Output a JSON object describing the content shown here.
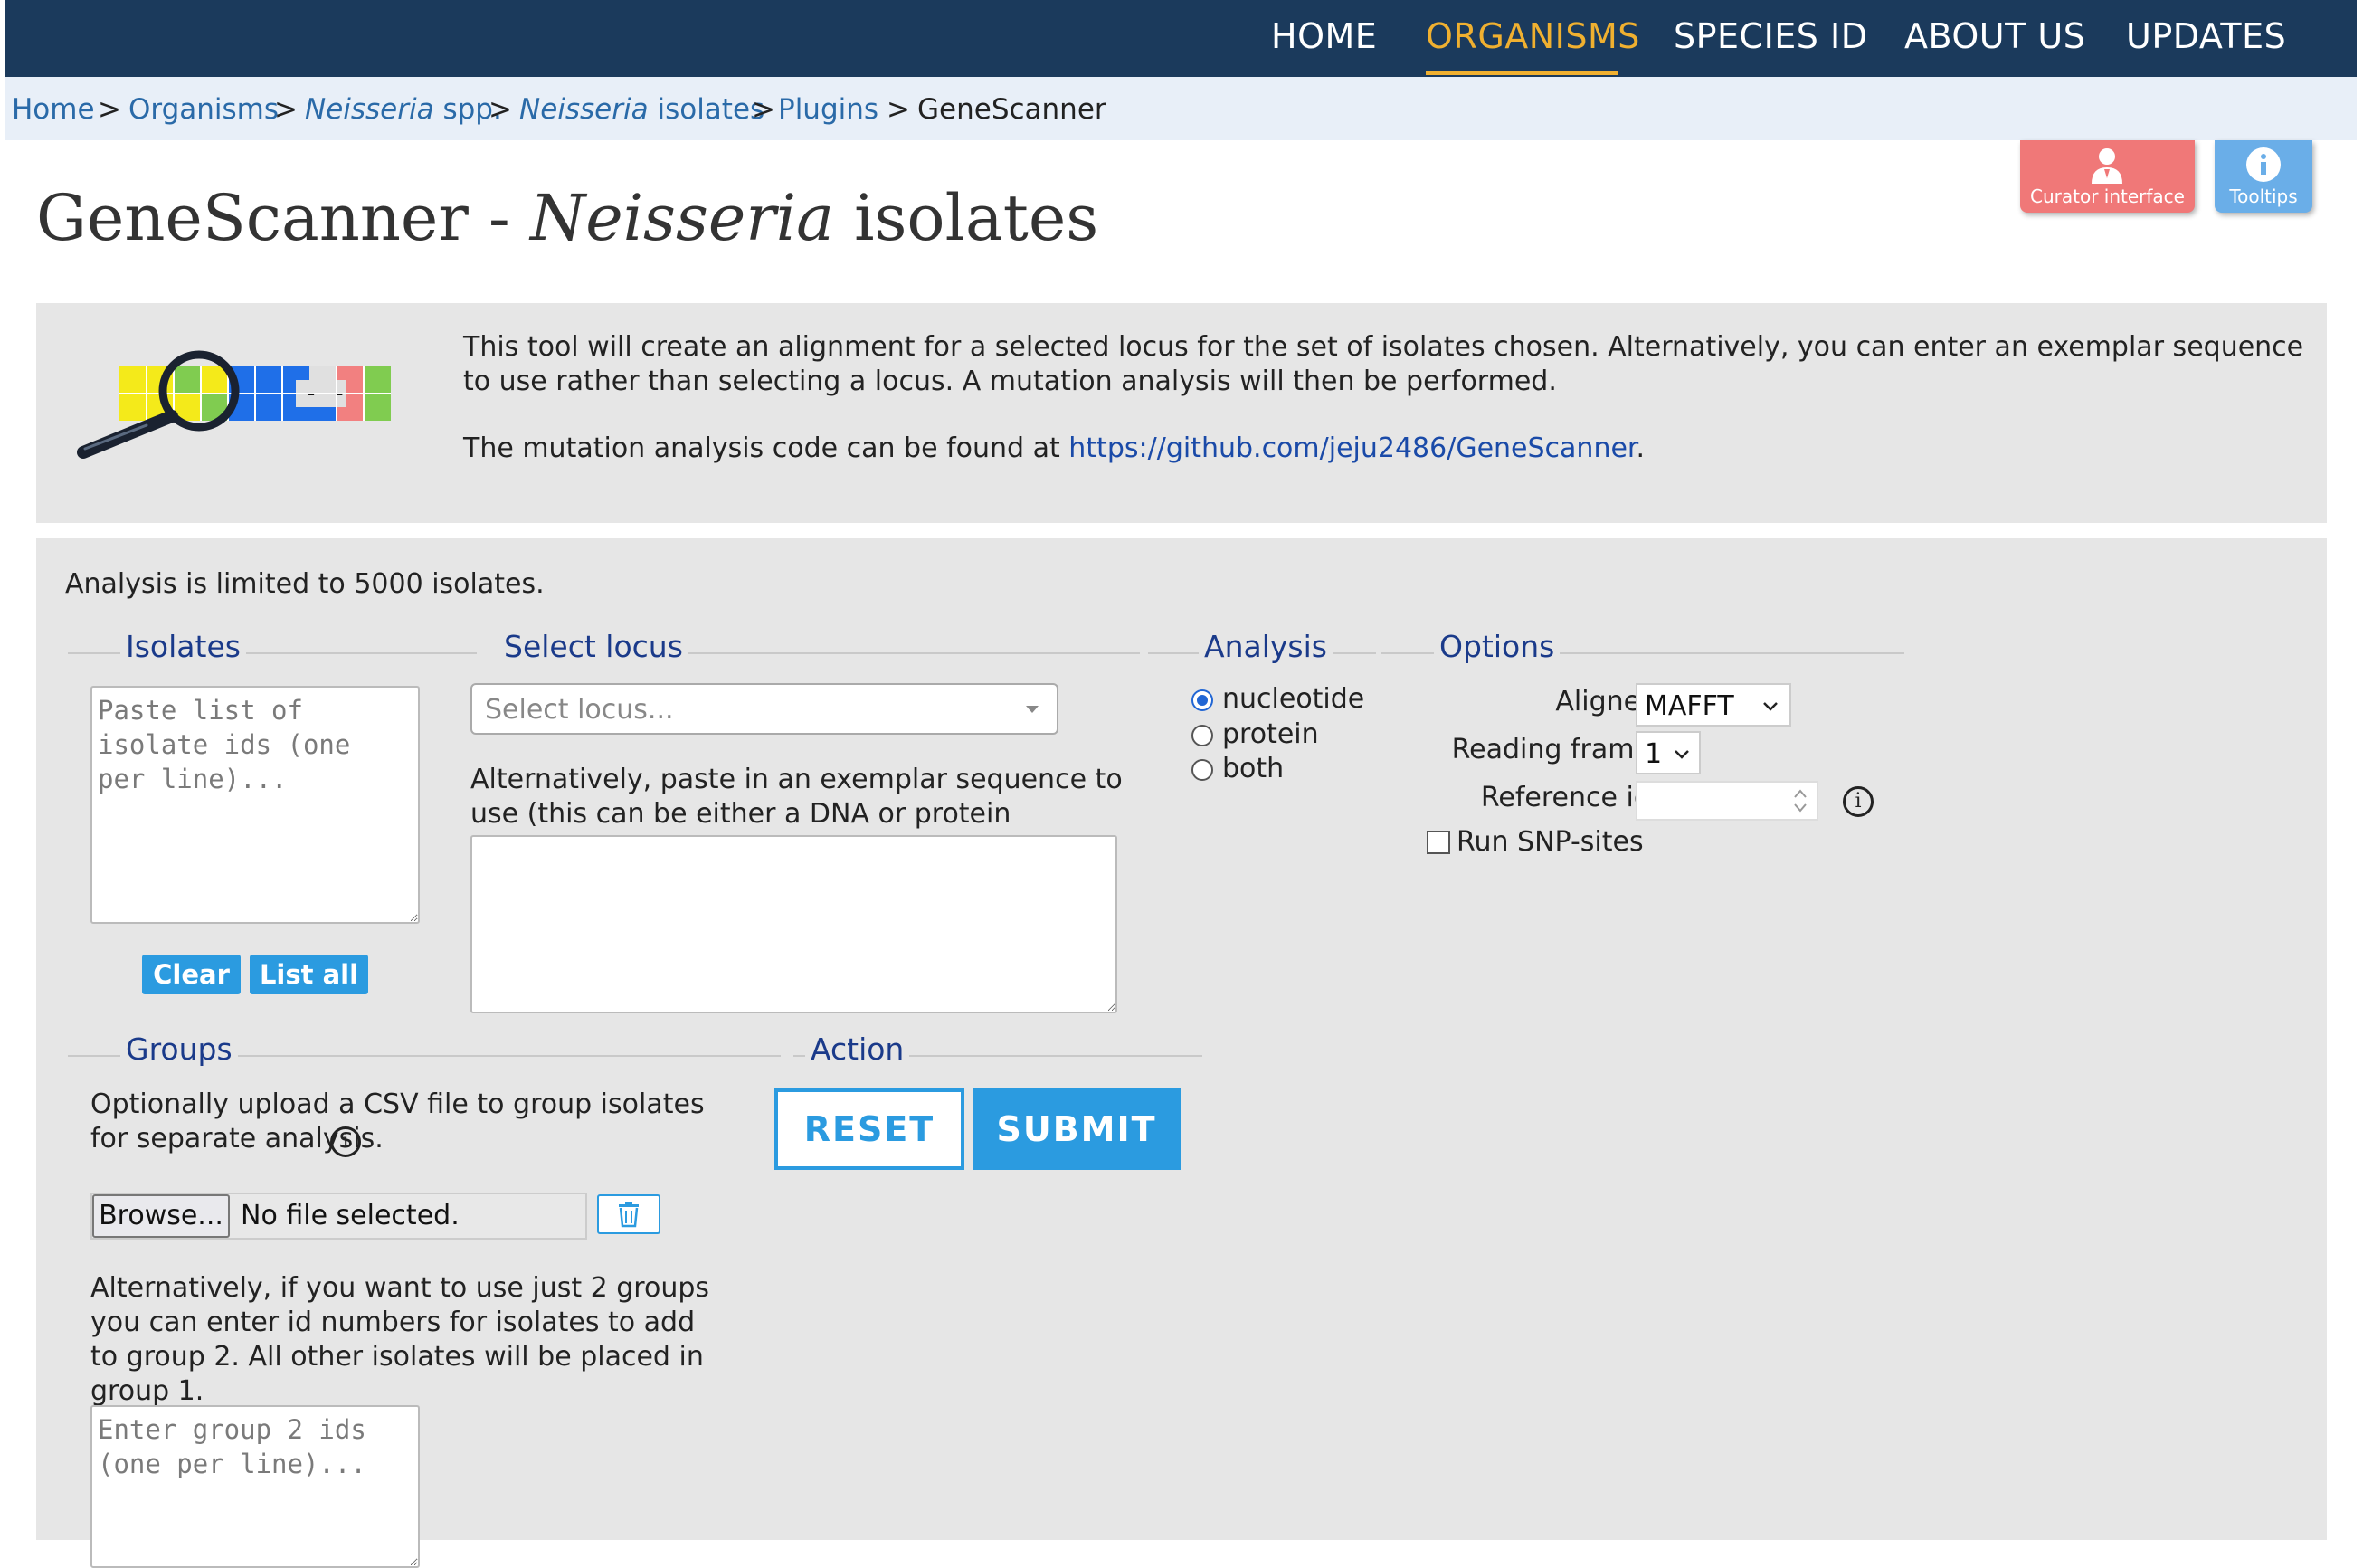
{
  "nav": {
    "items": [
      "HOME",
      "ORGANISMS",
      "SPECIES ID",
      "ABOUT US",
      "UPDATES"
    ],
    "active": "ORGANISMS"
  },
  "breadcrumb": {
    "home": "Home",
    "organisms": "Organisms",
    "neisseria_spp_italic": "Neisseria",
    "neisseria_spp_rest": " spp.",
    "isolates_italic": "Neisseria",
    "isolates_rest": " isolates",
    "plugins": "Plugins",
    "current": "GeneScanner",
    "separator": ">"
  },
  "floating": {
    "curator": "Curator interface",
    "tooltips": "Tooltips"
  },
  "title": {
    "prefix": "GeneScanner - ",
    "italic": "Neisseria",
    "suffix": " isolates"
  },
  "intro": {
    "line1": "This tool will create an alignment for a selected locus for the set of isolates chosen. Alternatively, you can enter an exemplar sequence to use rather than selecting a locus. A mutation analysis will then be performed.",
    "line2_prefix": "The mutation analysis code can be found at ",
    "link": "https://github.com/jeju2486/GeneScanner",
    "line2_suffix": "."
  },
  "form": {
    "limit_text": "Analysis is limited to 5000 isolates.",
    "isolates": {
      "legend": "Isolates",
      "placeholder": "Paste list of isolate ids (one per line)...",
      "clear": "Clear",
      "list_all": "List all"
    },
    "locus": {
      "legend": "Select locus",
      "placeholder": "Select locus...",
      "alt_text": "Alternatively, paste in an exemplar sequence to use (this can be either a DNA or protein sequence):"
    },
    "analysis": {
      "legend": "Analysis",
      "options": [
        "nucleotide",
        "protein",
        "both"
      ],
      "selected": "nucleotide"
    },
    "options": {
      "legend": "Options",
      "aligner_label": "Aligner:",
      "aligner_value": "MAFFT",
      "reading_frame_label": "Reading frame:",
      "reading_frame_value": "1",
      "reference_label": "Reference id:",
      "snp_label": "Run SNP-sites",
      "snp_checked": false
    },
    "groups": {
      "legend": "Groups",
      "upload_text": "Optionally upload a CSV file to group isolates for separate analysis.",
      "browse": "Browse...",
      "no_file": "No file selected.",
      "alt_text": "Alternatively, if you want to use just 2 groups you can enter id numbers for isolates to add to group 2. All other isolates will be placed in group 1.",
      "placeholder": "Enter group 2 ids (one per line)..."
    },
    "action": {
      "legend": "Action",
      "reset": "RESET",
      "submit": "SUBMIT"
    }
  },
  "colors": {
    "nav_bg": "#1b3a5c",
    "nav_active": "#f0b030",
    "link": "#2a6aa8",
    "button_blue": "#2b9be0",
    "curator_bg": "#f07878",
    "tooltips_bg": "#6aaee8"
  }
}
